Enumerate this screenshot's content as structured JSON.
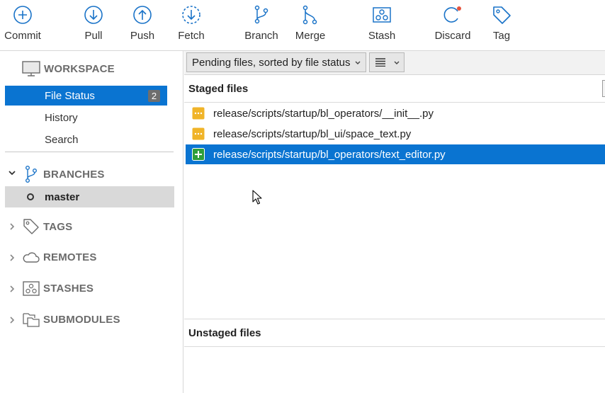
{
  "toolbar": {
    "commit": "Commit",
    "pull": "Pull",
    "push": "Push",
    "fetch": "Fetch",
    "branch": "Branch",
    "merge": "Merge",
    "stash": "Stash",
    "discard": "Discard",
    "tag": "Tag"
  },
  "sidebar": {
    "workspace": {
      "title": "WORKSPACE",
      "items": [
        {
          "label": "File Status",
          "badge": "2",
          "selected": true
        },
        {
          "label": "History"
        },
        {
          "label": "Search"
        }
      ]
    },
    "branches": {
      "title": "BRANCHES",
      "items": [
        {
          "label": "master",
          "current": true
        }
      ]
    },
    "tags": {
      "title": "TAGS"
    },
    "remotes": {
      "title": "REMOTES"
    },
    "stashes": {
      "title": "STASHES"
    },
    "submodules": {
      "title": "SUBMODULES"
    }
  },
  "filter": {
    "selected": "Pending files, sorted by file status"
  },
  "staged": {
    "title": "Staged files",
    "files": [
      {
        "name": "release/scripts/startup/bl_operators/__init__.py",
        "status": "modified"
      },
      {
        "name": "release/scripts/startup/bl_ui/space_text.py",
        "status": "modified"
      },
      {
        "name": "release/scripts/startup/bl_operators/text_editor.py",
        "status": "added",
        "selected": true
      }
    ]
  },
  "unstaged": {
    "title": "Unstaged files",
    "files": []
  },
  "colors": {
    "accent": "#0a74d1",
    "modified": "#f0b429",
    "added": "#2e9e3a",
    "discard_dot": "#e5533d"
  }
}
